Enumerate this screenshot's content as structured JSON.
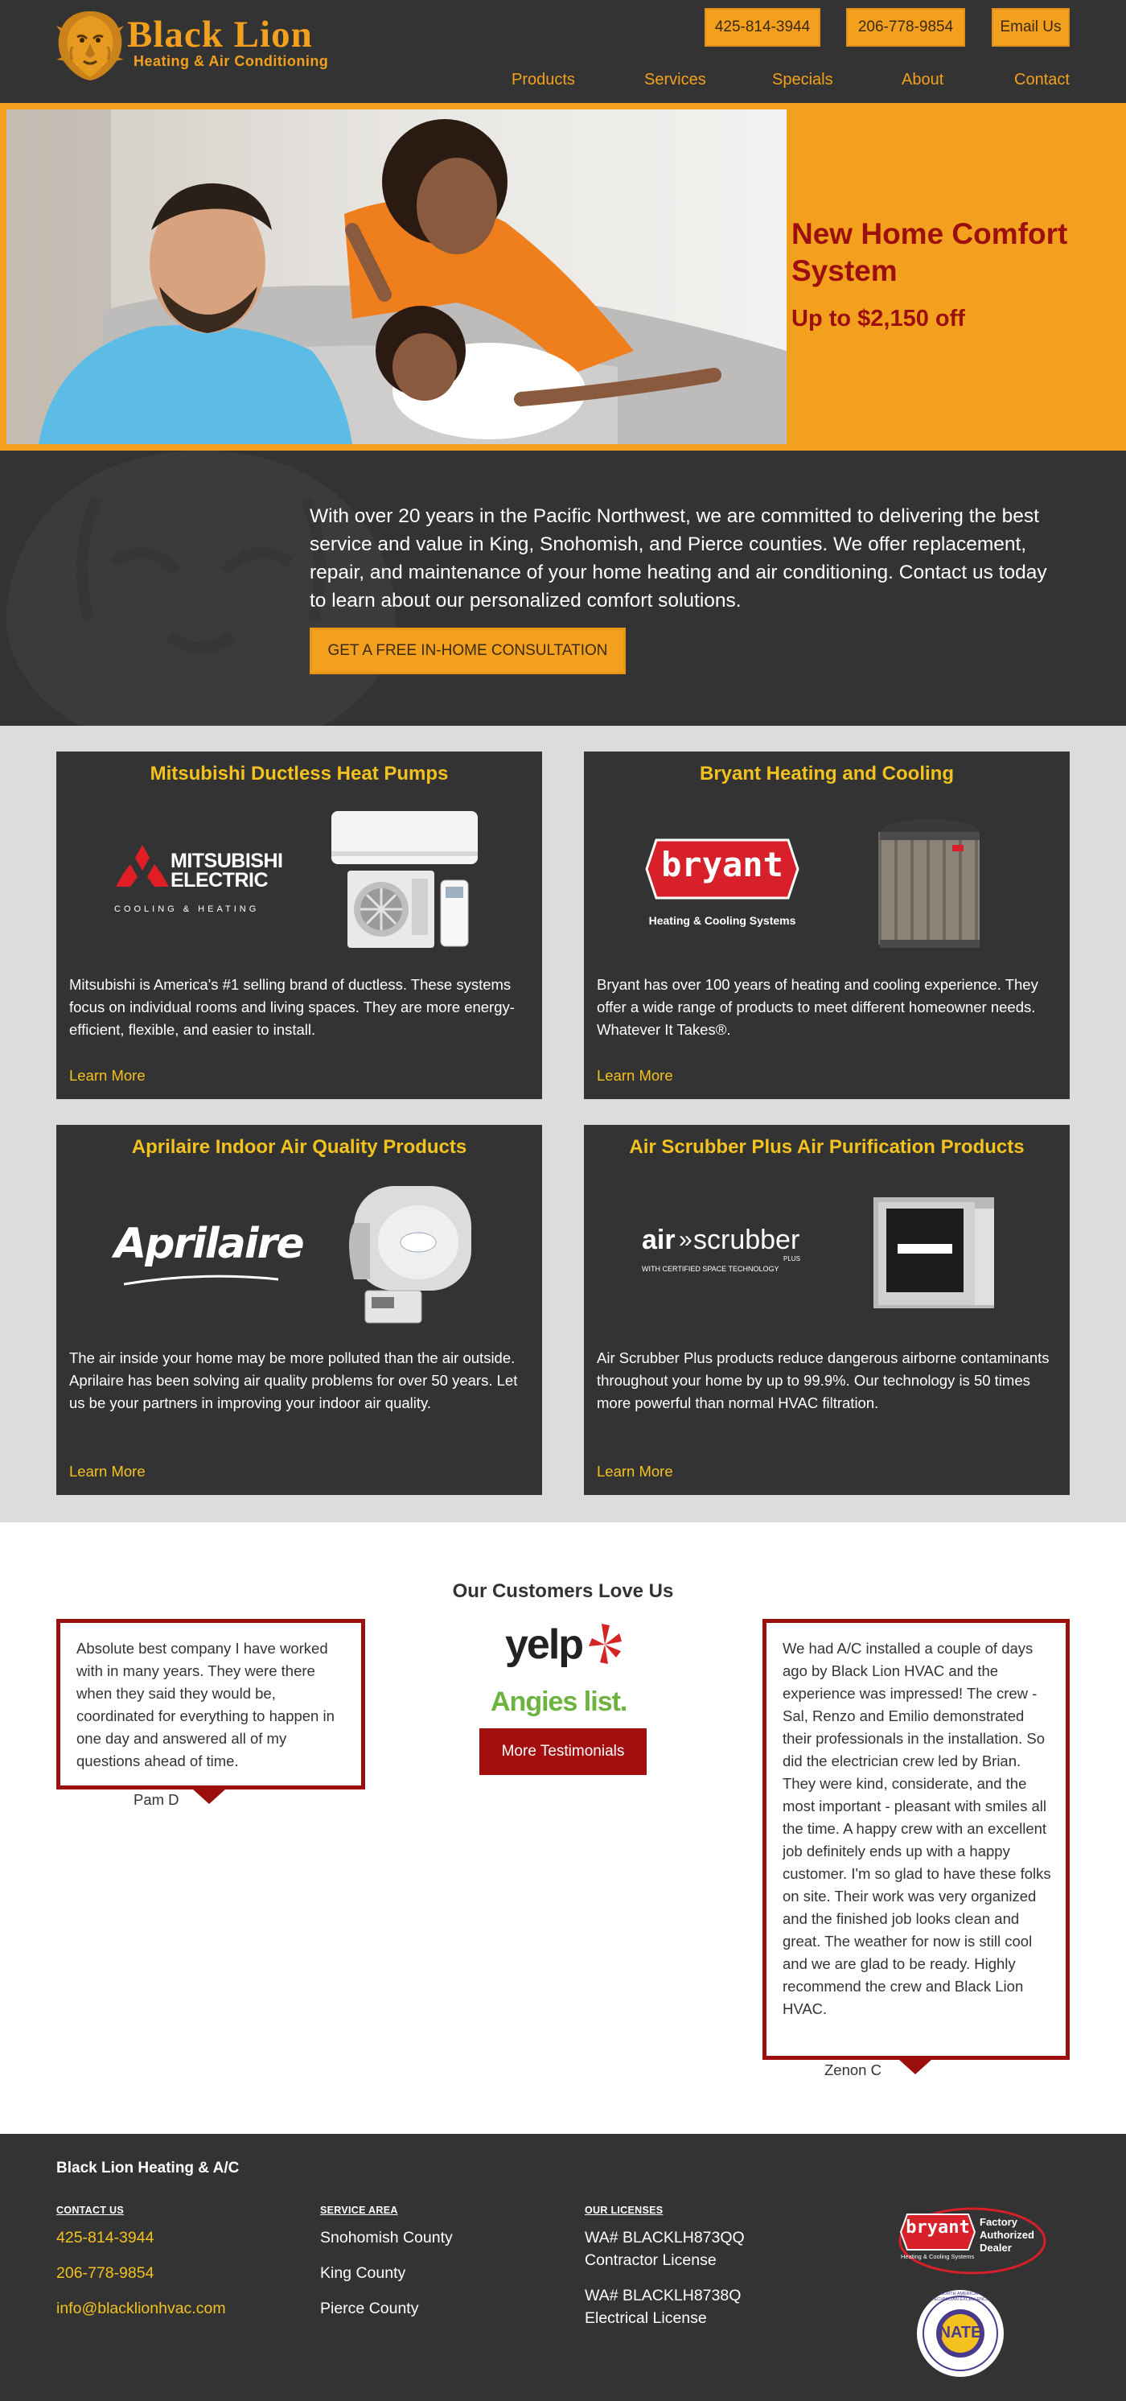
{
  "brand": {
    "name": "Black Lion",
    "tagline": "Heating & Air Conditioning",
    "color_orange": "#f3a01f",
    "color_dark": "#333333",
    "color_red": "#9b0f0f"
  },
  "header": {
    "phone_1": "425-814-3944",
    "phone_2": "206-778-9854",
    "email_label": "Email Us",
    "nav": [
      "Products",
      "Services",
      "Specials",
      "About",
      "Contact"
    ]
  },
  "hero": {
    "title": "New Home Comfort System",
    "subtitle": "Up to $2,150 off"
  },
  "intro": {
    "text": "With over 20 years in the Pacific Northwest, we are committed to delivering the best service and value in King, Snohomish, and Pierce counties. We offer replacement, repair, and maintenance of your home heating and air conditioning. Contact us today to learn about our personalized comfort solutions.",
    "button": "GET A FREE IN-HOME CONSULTATION"
  },
  "products": [
    {
      "title": "Mitsubishi Ductless Heat Pumps",
      "logo_line1": "MITSUBISHI",
      "logo_line2": "ELECTRIC",
      "logo_line3": "COOLING & HEATING",
      "text": "Mitsubishi is America's #1 selling brand of ductless. These systems focus on individual rooms and living spaces. They are more energy-efficient, flexible, and easier to install.",
      "link": "Learn More"
    },
    {
      "title": "Bryant Heating and Cooling",
      "logo_line1": "bryant",
      "logo_line2": "Heating & Cooling Systems",
      "text": "Bryant has over 100 years of heating and cooling experience. They offer a wide range of products to meet different homeowner needs. Whatever It Takes®.",
      "link": "Learn More"
    },
    {
      "title": "Aprilaire Indoor Air Quality Products",
      "logo_line1": "Aprilaire",
      "text": "The air inside your home may be more polluted than the air outside. Aprilaire has been solving air quality problems for over 50 years. Let us be your partners in improving your indoor air quality.",
      "link": "Learn More"
    },
    {
      "title": "Air Scrubber Plus Air Purification Products",
      "logo_line1": "air",
      "logo_line1b": "scrubber",
      "logo_plus": "PLUS",
      "logo_line2": "WITH CERTIFIED SPACE TECHNOLOGY",
      "text": "Air Scrubber Plus products reduce dangerous airborne contaminants throughout your home by up to 99.9%. Our technology is 50 times more powerful than normal HVAC filtration.",
      "link": "Learn More"
    }
  ],
  "testimonials": {
    "title": "Our Customers Love Us",
    "yelp_label": "yelp",
    "angies_label": "Angies list.",
    "more_button": "More Testimonials",
    "left": {
      "text": "Absolute best company I have worked with in many years. They were there when they said they would be, coordinated for everything to happen in one day and answered all of my questions ahead of time.",
      "author": "Pam D"
    },
    "right": {
      "text": "We had A/C installed a couple of days ago by Black Lion HVAC and the experience was impressed! The crew - Sal, Renzo and Emilio demonstrated their professionals in the installation. So did the electrician crew led by Brian. They were kind, considerate, and the most important - pleasant with smiles all the time. A happy crew with an excellent job definitely ends up with a happy customer. I'm so glad to have these folks on site. Their work was very organized and the finished job looks clean and great. The weather for now is still cool and we are glad to be ready. Highly recommend the crew and Black Lion HVAC.",
      "author": "Zenon C"
    }
  },
  "footer": {
    "brand": "Black Lion Heating & A/C",
    "contact_heading": "CONTACT US",
    "phone_1": "425-814-3944",
    "phone_2": "206-778-9854",
    "email": "info@blacklionhvac.com",
    "area_heading": "SERVICE AREA",
    "areas": [
      "Snohomish County",
      "King County",
      "Pierce County"
    ],
    "license_heading": "OUR LICENSES",
    "license_1_number": "WA# BLACKLH873QQ",
    "license_1_type": "Contractor License",
    "license_2_number": "WA# BLACKLH8738Q",
    "license_2_type": "Electrical License",
    "dealer_logo": "bryant",
    "dealer_badge_line1": "Factory",
    "dealer_badge_line2": "Authorized",
    "dealer_badge_line3": "Dealer",
    "dealer_sub": "Heating & Cooling Systems",
    "nate_label": "NATE",
    "nate_ring": "NORTH AMERICAN TECHNICIAN EXCELLENCE"
  }
}
